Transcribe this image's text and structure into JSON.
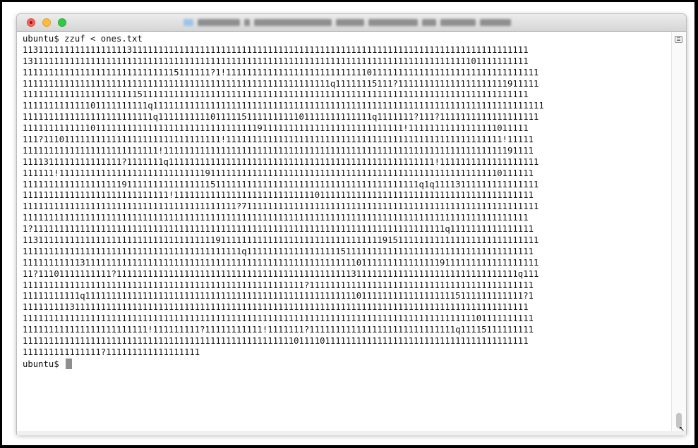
{
  "window": {
    "controls": {
      "close": "close-button",
      "minimize": "minimize-button",
      "zoom": "zoom-button"
    },
    "title_blurred": true
  },
  "terminal": {
    "command_line": "ubuntu$ zzuf < ones.txt",
    "output_lines": [
      "1131111111111111111131111111111111111111111111111111111111111111111111111111111111111111111111111",
      "1311111111111111111111111111111111111111111111111111111111111111111111111111111111111101111111111",
      "111111111111111111111111111115111111?1!111111111111111111111111111011111111111111111111111111111111",
      "11111111111111111111111111111111111111111111111111111111111q11111115111?111111111111111111111911111",
      "1111111111111111111111511111111111111111111111111111111111111111111111111111111111111111111111111",
      "111111111111101111111111q111111111111111111111111111111111111111111111111111111111111111111111111111",
      "1111111111111111111111111q11111111110111115111111111101111111111111q1111111?111?1111111111111111111",
      "1111111111111011111111111111111111111111111119111111111111111111111111111!11111111111111111011111",
      "111?1110111111111111111111111111111111!11111111111111111111111111111111111111111111111111111!11111",
      "11111111111111111111111111!11111111111111111111111111111111111111111111111111111111111111111191111",
      "1111311111111111111?1111111q111111111111111111111111111111111111111111111111111!1111111111111111111",
      "111111!1111111111111111111111111111911111111111111111111111111111111111111111111111111111110111111",
      "1111111111111111111911111111111111115111111111111111111111111111111111111111q1q11113111111111111111",
      "1111111111111111111111111111!111111111111111111111111111011111111111111111111111111111111111111111",
      "11111111111111111111111111111111111111111?711111111111111111111111111111111111111111111111111111111",
      "1111111111111111111111111111111111111111111111111111111111111111111111111111111111111111111111111",
      "1?1111111111111111111111111111111111111111111111111111111111111111111111111111111q1111111111111111",
      "113111111111111111111111111111111111191111111111111111111111111111111915111111111111111111111111111",
      "111111111111111111111111111111111111111111q1111111111111111115111111111111111111111111111111111111",
      "111111111113111111111111111111111111111111111111111111111111111101111111111111119111111111111111111",
      "11?11101111111111?11111111111111111111111111111111111111111111131111111111111111111111111111111q111",
      "111111111111111111111111111111111111111111111111111111?1111111111111111111111111111111111111111111",
      "11111111111q111111111111111111111111111111111111111111111111111101111111111111111115111111111111?1",
      "1111111113111111111111111111111111111111111111111111111111111111111111111111111111111111111111111",
      "11111111111111111111111111111111111111111111111111111111111111111111111111111111111111101111111111",
      "111111111111111111111111!111111111?11111111111!1111111?1111111111111111111111111111q11115111111111",
      "1111111111111111111111111111111111111111111111111111011110111111111111111111111111111111111111111",
      "111111111111111?111111111111111111"
    ],
    "prompt": "ubuntu$"
  },
  "scrollbar": {
    "menu_icon": "list-icon",
    "position": "bottom"
  }
}
